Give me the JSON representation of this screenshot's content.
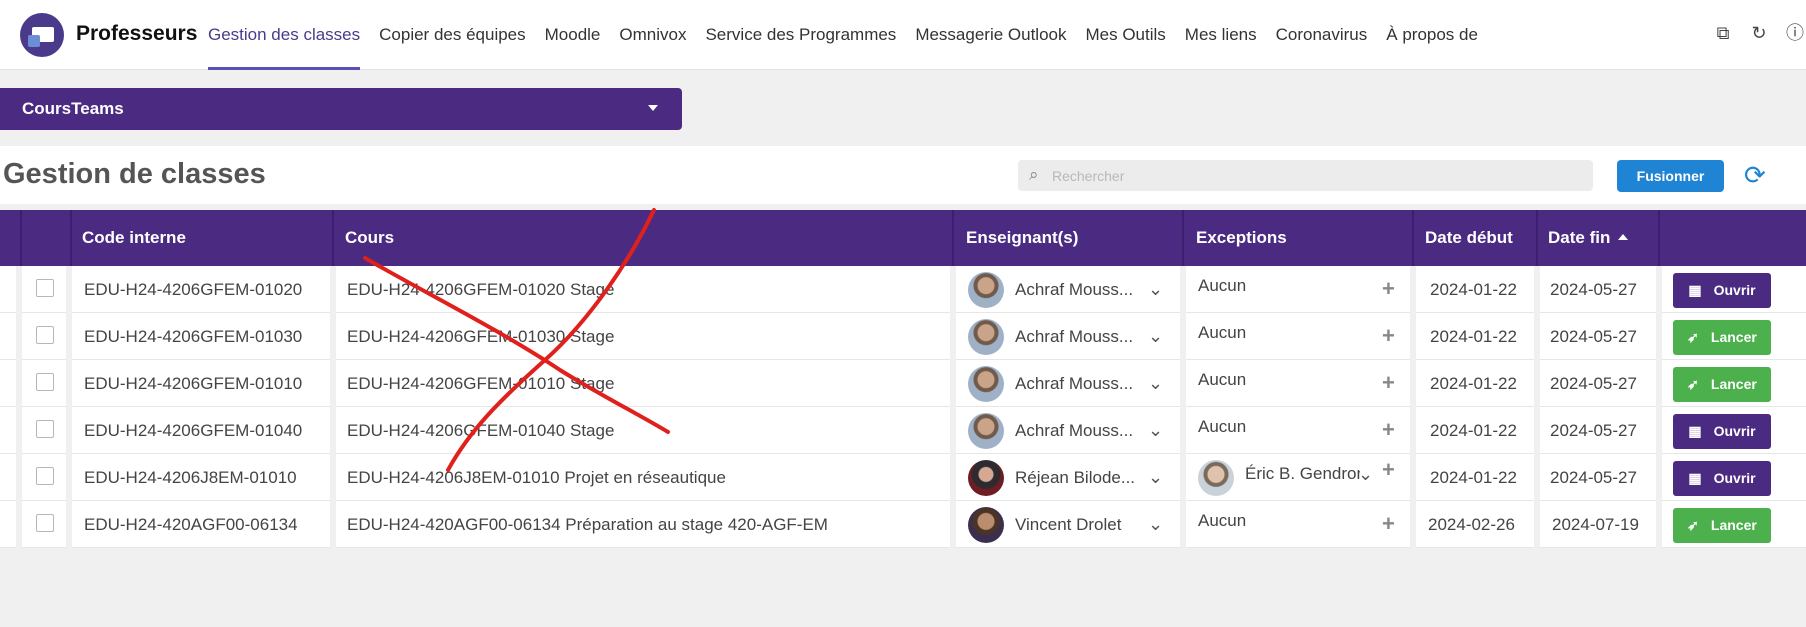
{
  "app": {
    "title": "Professeurs",
    "nav": [
      "Gestion des classes",
      "Copier des équipes",
      "Moodle",
      "Omnivox",
      "Service des Programmes",
      "Messagerie Outlook",
      "Mes Outils",
      "Mes liens",
      "Coronavirus",
      "À propos de"
    ],
    "active_tab": "Gestion des classes"
  },
  "team_select": {
    "value": "CoursTeams"
  },
  "page": {
    "title": "Gestion de classes",
    "search_placeholder": "Rechercher",
    "merge_label": "Fusionner"
  },
  "table": {
    "headers": {
      "code": "Code interne",
      "cours": "Cours",
      "enseignants": "Enseignant(s)",
      "exceptions": "Exceptions",
      "date_debut": "Date début",
      "date_fin": "Date fin"
    },
    "sort": {
      "column": "Date fin",
      "direction": "ascending"
    },
    "rows": [
      {
        "code": "EDU-H24-4206GFEM-01020",
        "cours": "EDU-H24-4206GFEM-01020 Stage",
        "enseignant": "Achraf Mouss...",
        "exception": "Aucun",
        "date_debut": "2024-01-22",
        "date_fin": "2024-05-27",
        "action": "Ouvrir"
      },
      {
        "code": "EDU-H24-4206GFEM-01030",
        "cours": "EDU-H24-4206GFEM-01030 Stage",
        "enseignant": "Achraf Mouss...",
        "exception": "Aucun",
        "date_debut": "2024-01-22",
        "date_fin": "2024-05-27",
        "action": "Lancer"
      },
      {
        "code": "EDU-H24-4206GFEM-01010",
        "cours": "EDU-H24-4206GFEM-01010 Stage",
        "enseignant": "Achraf Mouss...",
        "exception": "Aucun",
        "date_debut": "2024-01-22",
        "date_fin": "2024-05-27",
        "action": "Lancer"
      },
      {
        "code": "EDU-H24-4206GFEM-01040",
        "cours": "EDU-H24-4206GFEM-01040 Stage",
        "enseignant": "Achraf Mouss...",
        "exception": "Aucun",
        "date_debut": "2024-01-22",
        "date_fin": "2024-05-27",
        "action": "Ouvrir"
      },
      {
        "code": "EDU-H24-4206J8EM-01010",
        "cours": "EDU-H24-4206J8EM-01010 Projet en réseautique",
        "enseignant": "Réjean Bilode...",
        "exception": "Éric B. Gendron",
        "date_debut": "2024-01-22",
        "date_fin": "2024-05-27",
        "action": "Ouvrir"
      },
      {
        "code": "EDU-H24-420AGF00-06134",
        "cours": "EDU-H24-420AGF00-06134 Préparation au stage 420-AGF-EM",
        "enseignant": "Vincent Drolet",
        "exception": "Aucun",
        "date_debut": "2024-02-26",
        "date_fin": "2024-07-19",
        "action": "Lancer"
      }
    ]
  },
  "colors": {
    "primary": "#4b2a82",
    "accent": "#1f84d3",
    "success": "#4cb04c",
    "annotation": "#e0201c"
  }
}
